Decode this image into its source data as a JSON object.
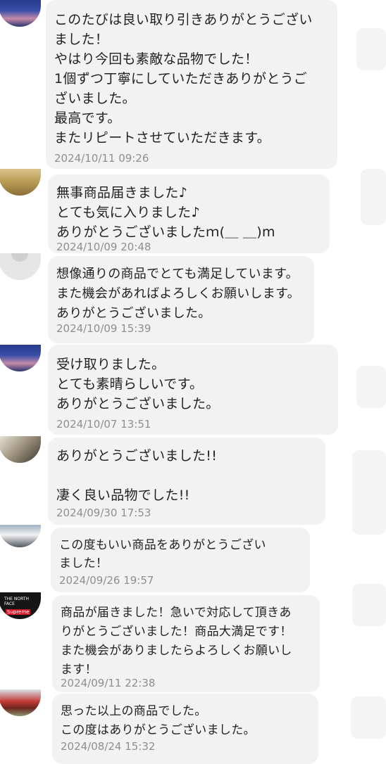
{
  "reviews": [
    {
      "avatar": "sakura-night-photo",
      "text": "このたびは良い取り引きありがとうござい\nました！\nやはり今回も素敵な品物でした！\n1個ずつ丁寧にしていただきありがとうご\nざいました。\n最高です。\nまたリピートさせていただきます。",
      "date": "2024/10/11 09:26"
    },
    {
      "avatar": "drink-can-photo",
      "text": "無事商品届きました♪\nとても気に入りました♪\nありがとうございましたｍ(＿ ＿)m",
      "date": "2024/10/09 20:48"
    },
    {
      "avatar": "default-user-avatar",
      "text": "想像通りの商品でとても満足しています。\nまた機会があればよろしくお願いします。\nありがとうございました。",
      "date": "2024/10/09 15:39"
    },
    {
      "avatar": "sakura-night-photo",
      "text": "受け取りました。\nとても素晴らしいです。\nありがとうございました。",
      "date": "2024/10/07 13:51"
    },
    {
      "avatar": "sketch-photo",
      "text": "ありがとうございました!!\n\n凄く良い品物でした!!",
      "date": "2024/09/30 17:53"
    },
    {
      "avatar": "car-photo",
      "text": "この度もいい商品をありがとうござい\nました！",
      "date": "2024/09/26 19:57"
    },
    {
      "avatar": "brand-logo-photo",
      "avatar_logo_top": "THE NORTH FACE",
      "avatar_logo_bottom": "Supreme",
      "text": "商品が届きました！急いで対応して頂きあ\nりがとうございました！商品大満足です！\nまた機会がありましたらよろしくお願いし\nます！",
      "date": "2024/09/11 22:38"
    },
    {
      "avatar": "red-truck-photo",
      "text": "思った以上の商品でした。\nこの度はありがとうございました。",
      "date": "2024/08/24 15:32"
    }
  ]
}
